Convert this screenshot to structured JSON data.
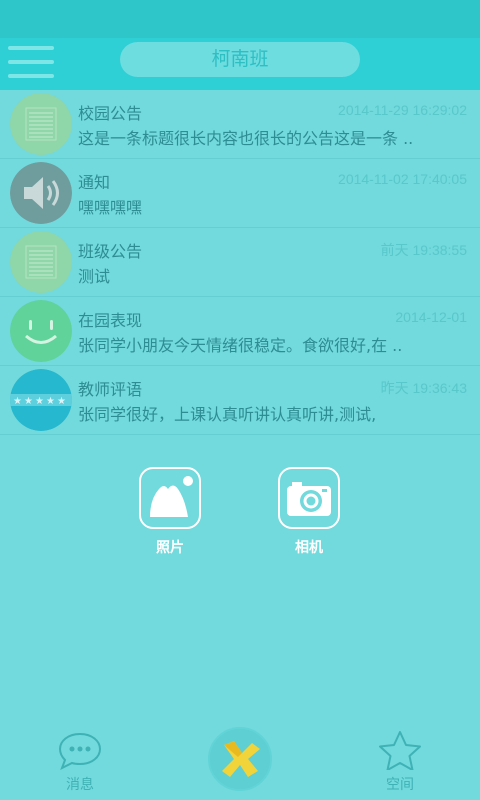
{
  "header": {
    "title": "柯南班"
  },
  "messages": [
    {
      "title": "校园公告",
      "time": "2014-11-29 16:29:02",
      "text": "这是一条标题很长内容也很长的公告这是一条 ..",
      "icon": "notice-board-icon"
    },
    {
      "title": "通知",
      "time": "2014-11-02 17:40:05",
      "text": "嘿嘿嘿嘿",
      "icon": "speaker-icon"
    },
    {
      "title": "班级公告",
      "time": "前天 19:38:55",
      "text": "测试",
      "icon": "notice-board-icon"
    },
    {
      "title": "在园表现",
      "time": "2014-12-01",
      "text": "张同学小朋友今天情绪很稳定。食欲很好,在 ..",
      "icon": "smiley-icon"
    },
    {
      "title": "教师评语",
      "time": "昨天 19:36:43",
      "text": "张同学很好，上课认真听讲认真听讲,测试,",
      "icon": "stars-icon"
    }
  ],
  "actions": {
    "photo_label": "照片",
    "camera_label": "相机"
  },
  "tabs": {
    "messages_label": "消息",
    "space_label": "空间"
  },
  "colors": {
    "background": "#72d9dc",
    "header": "#2ed0d5",
    "text": "#2e8d92",
    "time": "#58c8cb"
  }
}
